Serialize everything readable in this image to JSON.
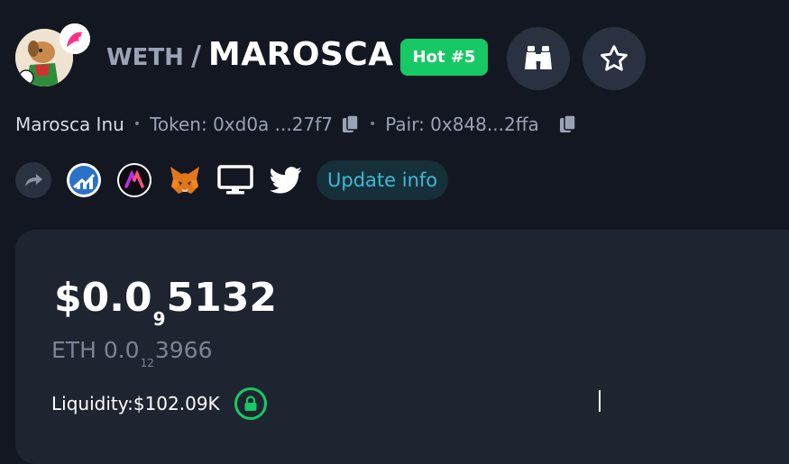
{
  "header": {
    "base_token": "WETH",
    "separator": "/",
    "quote_token": "MAROSCA",
    "hot_badge": "Hot #5"
  },
  "actions": {
    "watch_icon": "binoculars-icon",
    "favorite_icon": "star-icon"
  },
  "meta": {
    "token_name": "Marosca Inu",
    "token_label": "Token: 0xd0a ...27f7",
    "pair_label": "Pair: 0x848...2ffa"
  },
  "links": {
    "items": [
      "share-icon",
      "chart-icon",
      "aggregator-icon",
      "metamask-icon",
      "website-icon",
      "twitter-icon"
    ],
    "update_label": "Update info"
  },
  "price": {
    "usd_prefix": "$0.0",
    "usd_zeros": "9",
    "usd_digits": "5132",
    "eth_prefix": "ETH 0.0",
    "eth_zeros": "12",
    "eth_digits": "3966",
    "liquidity_label": "Liquidity:",
    "liquidity_value": "$102.09K"
  },
  "colors": {
    "background": "#131722",
    "card": "#1e2430",
    "accent_green": "#17c964",
    "accent_cyan": "#3fb8d6",
    "muted": "#9aa3b5"
  }
}
